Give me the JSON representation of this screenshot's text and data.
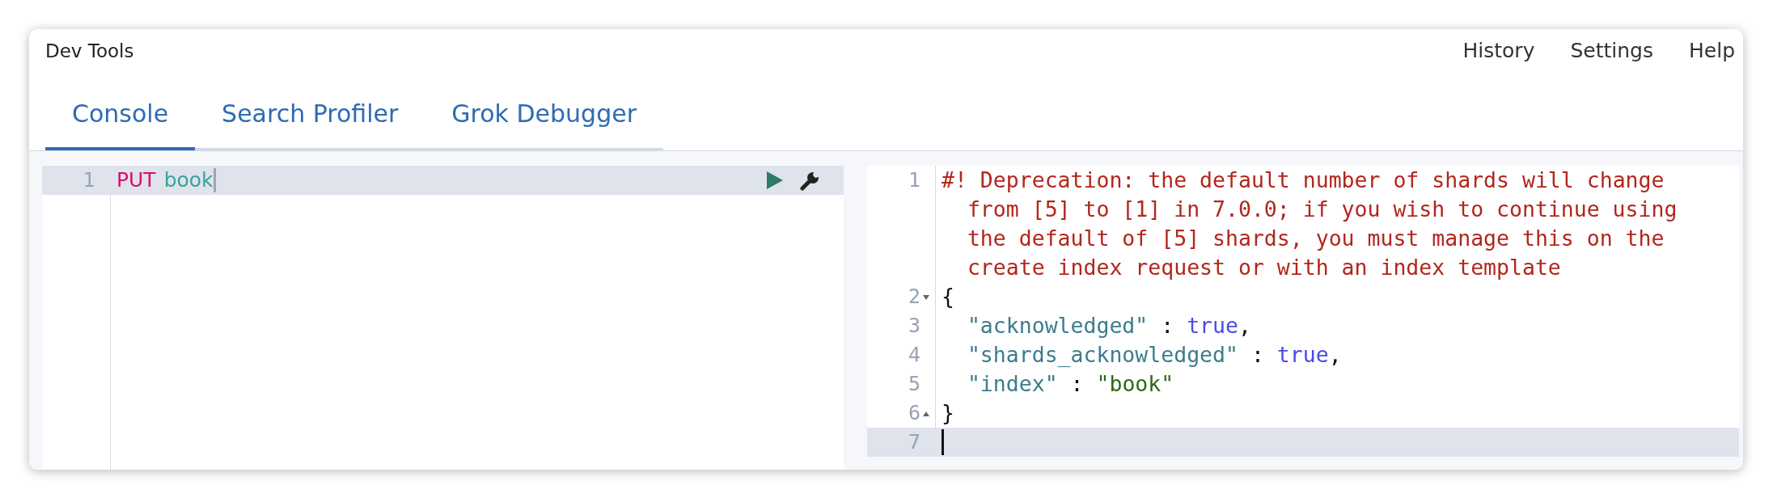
{
  "window": {
    "title": "Dev Tools"
  },
  "header_links": [
    "History",
    "Settings",
    "Help"
  ],
  "tabs": [
    {
      "label": "Console",
      "selected": true
    },
    {
      "label": "Search Profiler",
      "selected": false
    },
    {
      "label": "Grok Debugger",
      "selected": false
    }
  ],
  "request_editor": {
    "lines": [
      {
        "number": "1",
        "active": true,
        "tokens": [
          {
            "kind": "keyword",
            "text": "PUT"
          },
          {
            "kind": "path",
            "text": "book"
          }
        ]
      }
    ]
  },
  "response_editor": {
    "lines": [
      {
        "number": "1",
        "active": false,
        "fold_start": false,
        "fold_end": false,
        "tokens": [
          {
            "kind": "comment",
            "text": "#! Deprecation: the default number of shards will change from [5] to [1] in 7.0.0; if you wish to continue using the default of [5] shards, you must manage this on the create index request or with an index template"
          }
        ]
      },
      {
        "number": "2",
        "active": false,
        "fold_start": true,
        "fold_end": false,
        "tokens": [
          {
            "kind": "punct",
            "text": "{"
          }
        ]
      },
      {
        "number": "3",
        "active": false,
        "fold_start": false,
        "fold_end": false,
        "tokens": [
          {
            "kind": "key",
            "text": "  \"acknowledged\""
          },
          {
            "kind": "punct",
            "text": " : "
          },
          {
            "kind": "boolean",
            "text": "true"
          },
          {
            "kind": "punct",
            "text": ","
          }
        ]
      },
      {
        "number": "4",
        "active": false,
        "fold_start": false,
        "fold_end": false,
        "tokens": [
          {
            "kind": "key",
            "text": "  \"shards_acknowledged\""
          },
          {
            "kind": "punct",
            "text": " : "
          },
          {
            "kind": "boolean",
            "text": "true"
          },
          {
            "kind": "punct",
            "text": ","
          }
        ]
      },
      {
        "number": "5",
        "active": false,
        "fold_start": false,
        "fold_end": false,
        "tokens": [
          {
            "kind": "key",
            "text": "  \"index\""
          },
          {
            "kind": "punct",
            "text": " : "
          },
          {
            "kind": "string",
            "text": "\"book\""
          }
        ]
      },
      {
        "number": "6",
        "active": false,
        "fold_start": false,
        "fold_end": true,
        "tokens": [
          {
            "kind": "punct",
            "text": "}"
          }
        ]
      },
      {
        "number": "7",
        "active": true,
        "fold_start": false,
        "fold_end": false
      }
    ]
  }
}
